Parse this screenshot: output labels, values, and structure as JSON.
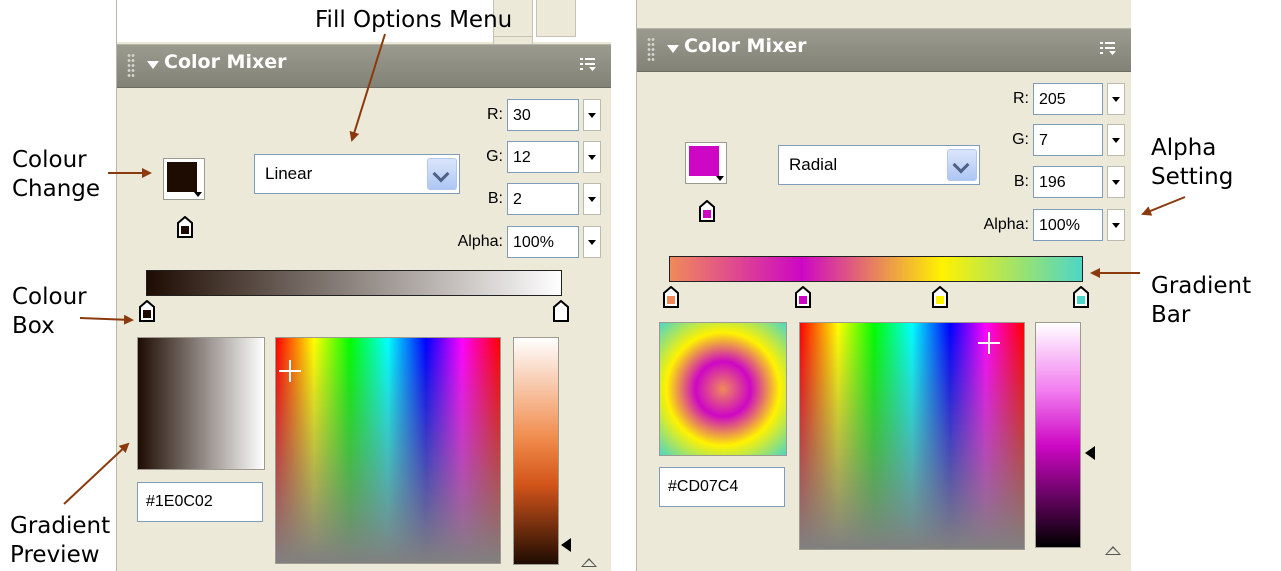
{
  "annotations": {
    "fill_options_menu": "Fill Options Menu",
    "colour_change": [
      "Colour",
      "Change"
    ],
    "colour_box": [
      "Colour",
      "Box"
    ],
    "gradient_preview": [
      "Gradient",
      "Preview"
    ],
    "alpha_setting": [
      "Alpha",
      "Setting"
    ],
    "gradient_bar": [
      "Gradient",
      "Bar"
    ]
  },
  "left_panel": {
    "title": "Color Mixer",
    "labels": {
      "r": "R:",
      "g": "G:",
      "b": "B:",
      "alpha": "Alpha:"
    },
    "values": {
      "r": "30",
      "g": "12",
      "b": "2",
      "alpha": "100%"
    },
    "fill_type": "Linear",
    "hex": "#1E0C02",
    "swatch_color": "#1E0C02"
  },
  "right_panel": {
    "title": "Color Mixer",
    "labels": {
      "r": "R:",
      "g": "G:",
      "b": "B:",
      "alpha": "Alpha:"
    },
    "values": {
      "r": "205",
      "g": "7",
      "b": "196",
      "alpha": "100%"
    },
    "fill_type": "Radial",
    "hex": "#CD07C4",
    "swatch_color": "#CD07C4",
    "gradient_stop_colors": [
      "#F08A5A",
      "#CD07C4",
      "#FFF200",
      "#4ED6C6"
    ]
  },
  "icons": {
    "collapse": "triangle-down-icon",
    "options": "panel-options-icon",
    "dropdown": "chevron-down-icon",
    "pointer": "gradient-pointer-icon",
    "crosshair": "crosshair-icon"
  }
}
